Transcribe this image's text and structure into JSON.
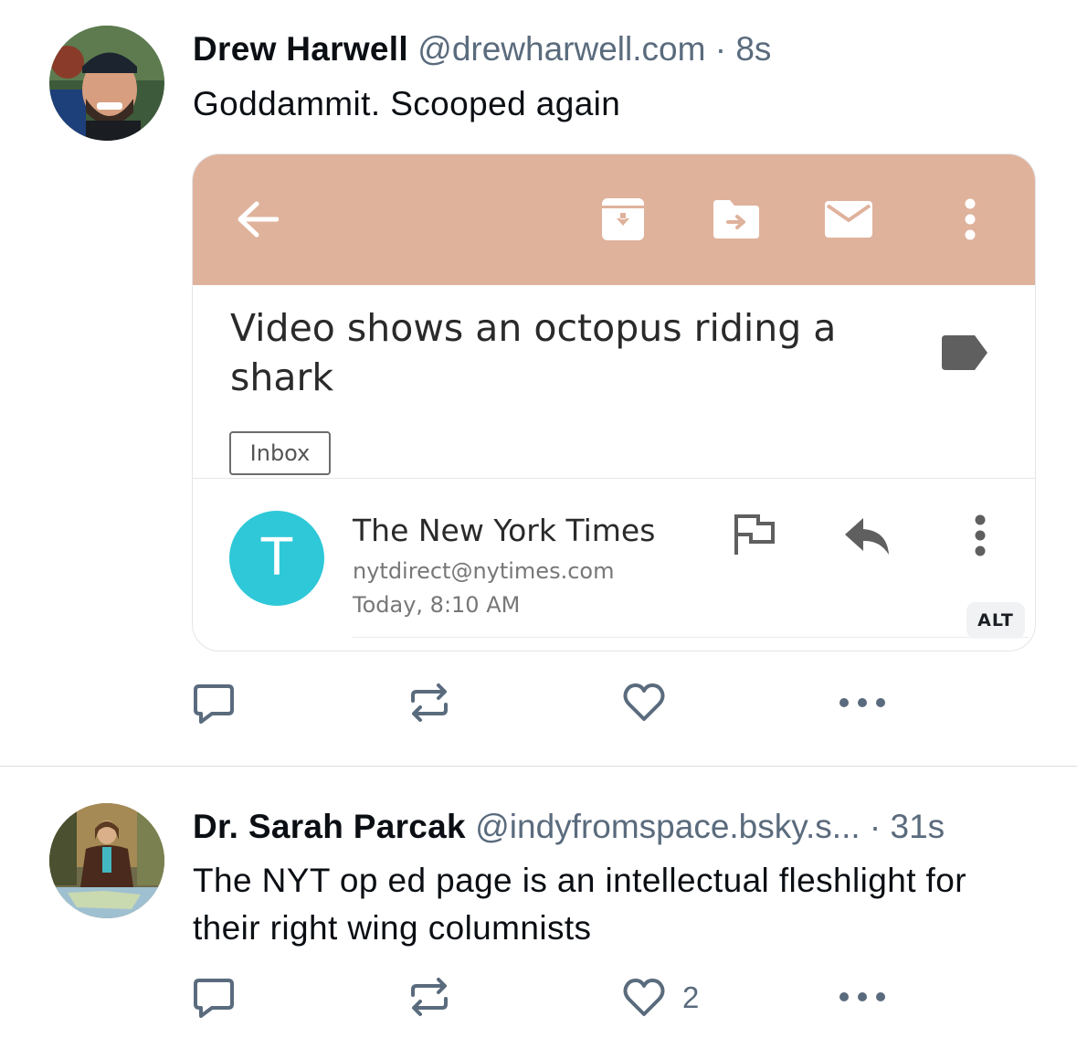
{
  "posts": [
    {
      "author_name": "Drew Harwell",
      "handle": "@drewharwell.com",
      "separator": "·",
      "time": "8s",
      "text": "Goddammit. Scooped again",
      "embed": {
        "subject": "Video shows an octopus riding a shark",
        "label": "Inbox",
        "sender_initial": "T",
        "sender_name": "The New York Times",
        "sender_email": "nytdirect@nytimes.com",
        "date": "Today, 8:10 AM",
        "alt_badge": "ALT",
        "toolbar_color": "#dfb29c",
        "avatar_color": "#2ec8d8",
        "toolbar_icons": [
          "back-arrow-icon",
          "archive-icon",
          "move-to-folder-icon",
          "mail-icon",
          "more-vertical-icon"
        ]
      },
      "actions": {
        "reply_count": "",
        "repost_count": "",
        "like_count": ""
      }
    },
    {
      "author_name": "Dr. Sarah Parcak",
      "handle": "@indyfromspace.bsky.s...",
      "separator": "·",
      "time": "31s",
      "text": "The NYT op ed page is an intellectual fleshlight for their right wing columnists",
      "actions": {
        "reply_count": "",
        "repost_count": "",
        "like_count": "2"
      }
    }
  ],
  "colors": {
    "muted": "#5a6b7d",
    "text": "#0b0f14",
    "icon": "#5a6b7d"
  }
}
